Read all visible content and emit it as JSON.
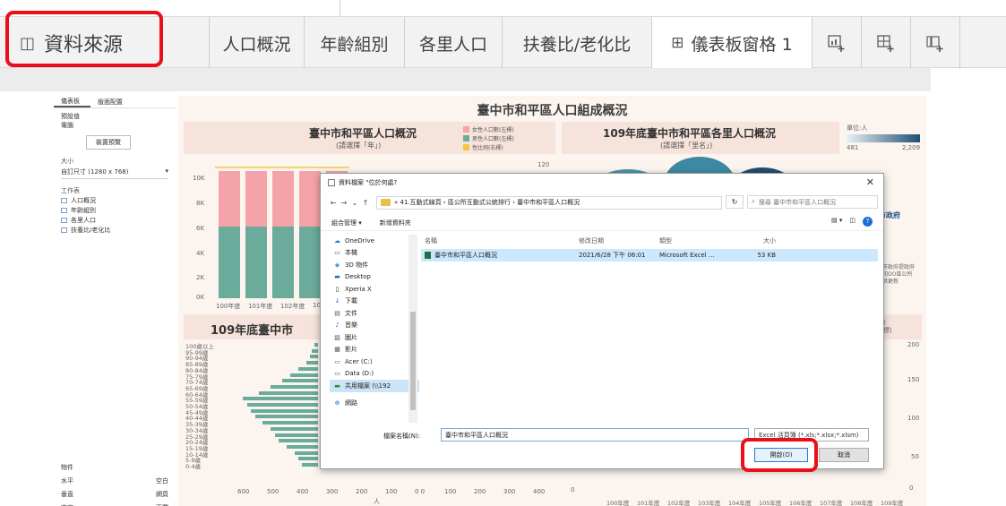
{
  "tabbar": {
    "datasource_label": "資料來源",
    "tabs": [
      {
        "label": "人口概況"
      },
      {
        "label": "年齡組別"
      },
      {
        "label": "各里人口"
      },
      {
        "label": "扶養比/老化比"
      },
      {
        "label": "儀表板窗格 1"
      }
    ],
    "icons": [
      "new-worksheet-icon",
      "new-dashboard-icon",
      "new-story-icon"
    ]
  },
  "left_panel": {
    "tab_dashboard": "儀表板",
    "tab_layout": "版面配置",
    "default_label": "預設值",
    "device_label": "電腦",
    "preview_button": "裝置預覽",
    "size_label": "大小",
    "size_value": "自訂尺寸 (1280 x 768)",
    "sheets_label": "工作表",
    "sheets": [
      "人口概況",
      "年齡組別",
      "各里人口",
      "扶養比/老化比"
    ],
    "objects_label": "物件",
    "objects": [
      "水平",
      "空白",
      "垂直",
      "網頁",
      "文字",
      "下載"
    ]
  },
  "dashboard": {
    "title": "臺中市和平區人口組成概況",
    "panel1_title": "臺中市和平區人口概況",
    "panel1_sub": "(請選擇「年」)",
    "legend": [
      {
        "label": "女性人口數(左標)",
        "color": "#f4a3a8"
      },
      {
        "label": "男性人口數(左標)",
        "color": "#6aab9c"
      },
      {
        "label": "性比例(右標)",
        "color": "#f4c542"
      }
    ],
    "panel2_title": "109年底臺中市和平區各里人口概況",
    "panel2_sub": "(請選擇「里名」)",
    "scale_label": "單位:人",
    "scale_min": "481",
    "scale_max": "2,209",
    "panel3_title": "109年底臺中市",
    "panel1_yticks": [
      "10K",
      "8K",
      "6K",
      "4K",
      "2K",
      "0K"
    ],
    "panel1_right_tick": "120",
    "panel1_xticks": [
      "100年度",
      "101年度",
      "102年度",
      "10"
    ],
    "pyramid_age_groups": [
      "100歲以上",
      "95-99歲",
      "90-94歲",
      "85-89歲",
      "80-84歲",
      "75-79歲",
      "70-74歲",
      "65-69歲",
      "60-64歲",
      "55-59歲",
      "50-54歲",
      "45-49歲",
      "40-44歲",
      "35-39歲",
      "30-34歲",
      "25-29歲",
      "20-24歲",
      "15-19歲",
      "10-14歲",
      "5-9歲",
      "0-4歲"
    ],
    "pyramid_xticks": [
      "600",
      "500",
      "400",
      "300",
      "200",
      "100",
      "0 0",
      "100",
      "200",
      "300",
      "400"
    ],
    "pyramid_xlabel": "人",
    "line_yticks": [
      "200",
      "150",
      "100",
      "50",
      "0"
    ],
    "line_xticks": [
      "100年度",
      "101年度",
      "102年度",
      "103年度",
      "104年度",
      "105年度",
      "106年度",
      "107年度",
      "108年度",
      "109年度"
    ],
    "right_logo_text": "市政府",
    "right_note_1": "中市政府提政府",
    "right_note_2": "市和OO區公所",
    "right_note_3": "提供更新",
    "right_legend_1": "標)",
    "right_legend_2": "右標)"
  },
  "dialog": {
    "title": "資料檔案 \"位於何處?",
    "breadcrumb": "« 41.互動式線頁 › 區公所互動式公統排行 › 臺中市和平區人口概況",
    "refresh": "↻",
    "search_placeholder": "搜尋 臺中市和平區人口概況",
    "toolbar_organize": "組合管理 ▾",
    "toolbar_newfolder": "新增資料夾",
    "nav_items": [
      {
        "label": "OneDrive",
        "icon": "cloud-icon"
      },
      {
        "label": "本機",
        "icon": "computer-icon"
      },
      {
        "label": "3D 物件",
        "icon": "cube-icon"
      },
      {
        "label": "Desktop",
        "icon": "desktop-icon"
      },
      {
        "label": "Xperia X",
        "icon": "phone-icon"
      },
      {
        "label": "下載",
        "icon": "download-icon"
      },
      {
        "label": "文件",
        "icon": "document-icon"
      },
      {
        "label": "音樂",
        "icon": "music-icon"
      },
      {
        "label": "圖片",
        "icon": "picture-icon"
      },
      {
        "label": "影片",
        "icon": "video-icon"
      },
      {
        "label": "Acer (C:)",
        "icon": "drive-icon"
      },
      {
        "label": "Data (D:)",
        "icon": "drive-icon"
      },
      {
        "label": "共用檔案 (\\\\192",
        "icon": "network-drive-icon"
      },
      {
        "label": "網路",
        "icon": "network-icon"
      }
    ],
    "columns": {
      "name": "名稱",
      "date": "修改日期",
      "type": "類型",
      "size": "大小"
    },
    "files": [
      {
        "name": "臺中市和平區人口概況",
        "date": "2021/6/28 下午 06:01",
        "type": "Microsoft Excel ...",
        "size": "53 KB"
      }
    ],
    "filename_label": "檔案名稱(N):",
    "filename_value": "臺中市和平區人口概況",
    "filetype_value": "Excel 活頁簿 (*.xls;*.xlsx;*.xlsm)",
    "open_button": "開啟(O)",
    "cancel_button": "取消"
  }
}
